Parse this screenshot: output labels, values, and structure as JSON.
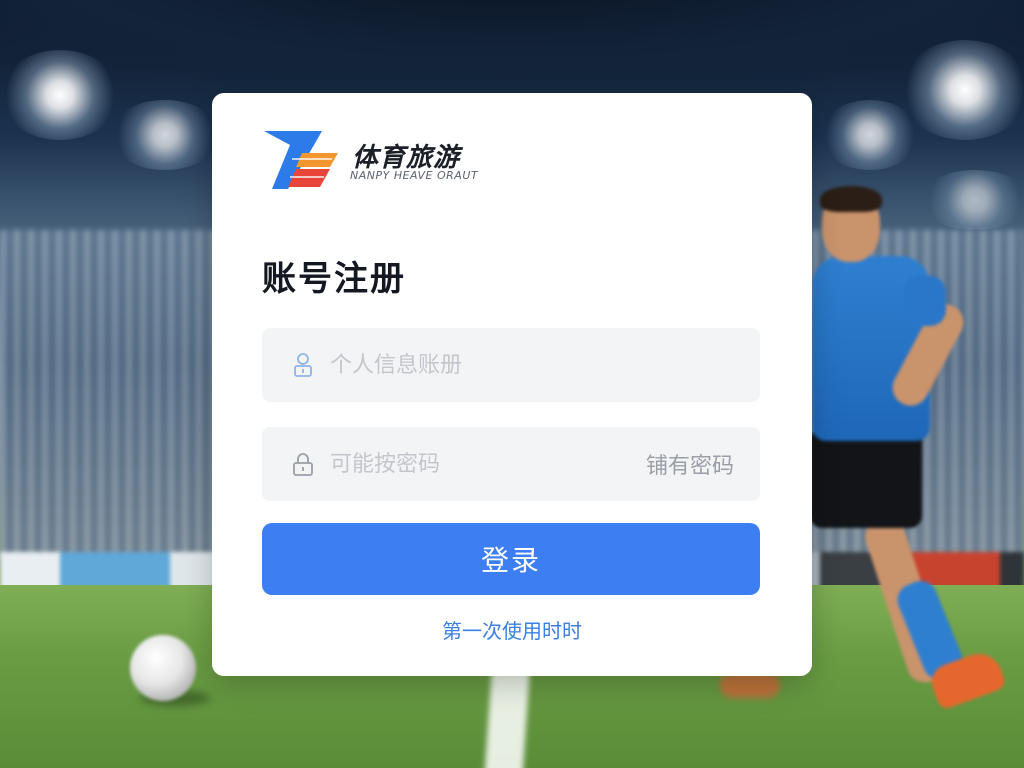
{
  "brand": {
    "name": "体育旅游",
    "tagline": "NANPY HEAVE ORAUT"
  },
  "form": {
    "title": "账号注册",
    "account_placeholder": "个人信息账册",
    "password_placeholder": "可能按密码",
    "password_aside": "铺有密码",
    "login_label": "登录",
    "first_use_link": "第一次使用时时"
  },
  "icons": {
    "account": "user-icon",
    "password": "lock-icon"
  },
  "colors": {
    "accent": "#3d7ff2",
    "link": "#3b7fe0",
    "logo_blue": "#2d7be8",
    "logo_orange": "#f2962e",
    "logo_red": "#e8463a"
  }
}
